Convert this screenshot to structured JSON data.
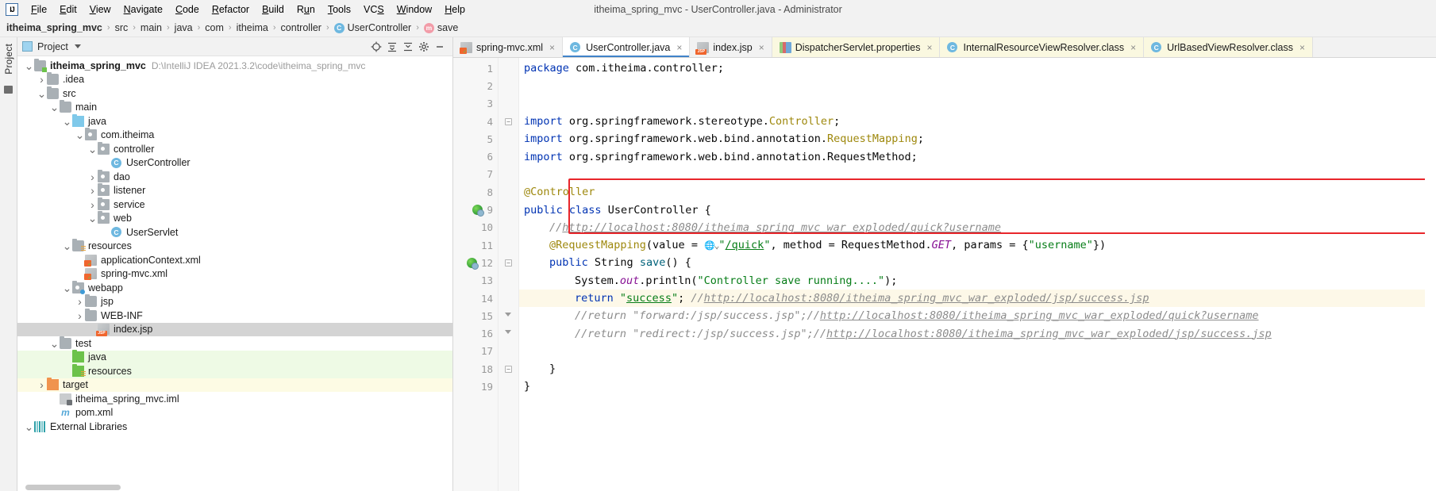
{
  "window": {
    "title": "itheima_spring_mvc - UserController.java - Administrator",
    "logo": "intellij-idea-logo"
  },
  "menu": {
    "items": [
      {
        "label": "File",
        "mnemonic": "F"
      },
      {
        "label": "Edit",
        "mnemonic": "E"
      },
      {
        "label": "View",
        "mnemonic": "V"
      },
      {
        "label": "Navigate",
        "mnemonic": "N"
      },
      {
        "label": "Code",
        "mnemonic": "C"
      },
      {
        "label": "Refactor",
        "mnemonic": "R"
      },
      {
        "label": "Build",
        "mnemonic": "B"
      },
      {
        "label": "Run",
        "mnemonic": "u"
      },
      {
        "label": "Tools",
        "mnemonic": "T"
      },
      {
        "label": "VCS",
        "mnemonic": "S"
      },
      {
        "label": "Window",
        "mnemonic": "W"
      },
      {
        "label": "Help",
        "mnemonic": "H"
      }
    ]
  },
  "breadcrumb": {
    "items": [
      {
        "label": "itheima_spring_mvc",
        "bold": true,
        "icon": ""
      },
      {
        "label": "src",
        "bold": false,
        "icon": ""
      },
      {
        "label": "main",
        "bold": false,
        "icon": ""
      },
      {
        "label": "java",
        "bold": false,
        "icon": ""
      },
      {
        "label": "com",
        "bold": false,
        "icon": ""
      },
      {
        "label": "itheima",
        "bold": false,
        "icon": ""
      },
      {
        "label": "controller",
        "bold": false,
        "icon": ""
      },
      {
        "label": "UserController",
        "bold": false,
        "icon": "class-icon",
        "badge": "C"
      },
      {
        "label": "save",
        "bold": false,
        "icon": "method-icon",
        "badge": "m"
      }
    ],
    "separator": "›"
  },
  "tool_window_strip": {
    "label": "Project"
  },
  "project_panel": {
    "header": {
      "title": "Project",
      "dropdown": "chevron-down-icon",
      "buttons": [
        "locate-icon",
        "collapse-all-icon",
        "hide-icon",
        "settings-icon",
        "minimize-icon"
      ]
    },
    "tree": [
      {
        "label": "itheima_spring_mvc",
        "path": "D:\\IntelliJ IDEA 2021.3.2\\code\\itheima_spring_mvc",
        "indent": 0,
        "arrow": "v",
        "icon": "module-folder",
        "bold": true,
        "bg": ""
      },
      {
        "label": ".idea",
        "path": "",
        "indent": 1,
        "arrow": ">",
        "icon": "folder",
        "bold": false,
        "bg": ""
      },
      {
        "label": "src",
        "path": "",
        "indent": 1,
        "arrow": "v",
        "icon": "folder",
        "bold": false,
        "bg": ""
      },
      {
        "label": "main",
        "path": "",
        "indent": 2,
        "arrow": "v",
        "icon": "folder",
        "bold": false,
        "bg": ""
      },
      {
        "label": "java",
        "path": "",
        "indent": 3,
        "arrow": "v",
        "icon": "source-folder",
        "bold": false,
        "bg": ""
      },
      {
        "label": "com.itheima",
        "path": "",
        "indent": 4,
        "arrow": "v",
        "icon": "package",
        "bold": false,
        "bg": ""
      },
      {
        "label": "controller",
        "path": "",
        "indent": 5,
        "arrow": "v",
        "icon": "package",
        "bold": false,
        "bg": ""
      },
      {
        "label": "UserController",
        "path": "",
        "indent": 6,
        "arrow": "",
        "icon": "java-class",
        "bold": false,
        "bg": ""
      },
      {
        "label": "dao",
        "path": "",
        "indent": 5,
        "arrow": ">",
        "icon": "package",
        "bold": false,
        "bg": ""
      },
      {
        "label": "listener",
        "path": "",
        "indent": 5,
        "arrow": ">",
        "icon": "package",
        "bold": false,
        "bg": ""
      },
      {
        "label": "service",
        "path": "",
        "indent": 5,
        "arrow": ">",
        "icon": "package",
        "bold": false,
        "bg": ""
      },
      {
        "label": "web",
        "path": "",
        "indent": 5,
        "arrow": "v",
        "icon": "package",
        "bold": false,
        "bg": ""
      },
      {
        "label": "UserServlet",
        "path": "",
        "indent": 6,
        "arrow": "",
        "icon": "java-class",
        "bold": false,
        "bg": ""
      },
      {
        "label": "resources",
        "path": "",
        "indent": 3,
        "arrow": "v",
        "icon": "resources-folder",
        "bold": false,
        "bg": ""
      },
      {
        "label": "applicationContext.xml",
        "path": "",
        "indent": 4,
        "arrow": "",
        "icon": "spring-xml",
        "bold": false,
        "bg": ""
      },
      {
        "label": "spring-mvc.xml",
        "path": "",
        "indent": 4,
        "arrow": "",
        "icon": "spring-xml",
        "bold": false,
        "bg": ""
      },
      {
        "label": "webapp",
        "path": "",
        "indent": 3,
        "arrow": "v",
        "icon": "webapp-folder",
        "bold": false,
        "bg": ""
      },
      {
        "label": "jsp",
        "path": "",
        "indent": 4,
        "arrow": ">",
        "icon": "folder",
        "bold": false,
        "bg": ""
      },
      {
        "label": "WEB-INF",
        "path": "",
        "indent": 4,
        "arrow": ">",
        "icon": "folder",
        "bold": false,
        "bg": ""
      },
      {
        "label": "index.jsp",
        "path": "",
        "indent": 5,
        "arrow": "",
        "icon": "jsp-file",
        "bold": false,
        "bg": "selected"
      },
      {
        "label": "test",
        "path": "",
        "indent": 2,
        "arrow": "v",
        "icon": "folder",
        "bold": false,
        "bg": ""
      },
      {
        "label": "java",
        "path": "",
        "indent": 3,
        "arrow": "",
        "icon": "test-source-folder",
        "bold": false,
        "bg": "green"
      },
      {
        "label": "resources",
        "path": "",
        "indent": 3,
        "arrow": "",
        "icon": "test-resources-folder",
        "bold": false,
        "bg": "green"
      },
      {
        "label": "target",
        "path": "",
        "indent": 1,
        "arrow": ">",
        "icon": "excluded-folder",
        "bold": false,
        "bg": "yellow"
      },
      {
        "label": "itheima_spring_mvc.iml",
        "path": "",
        "indent": 2,
        "arrow": "",
        "icon": "iml-file",
        "bold": false,
        "bg": ""
      },
      {
        "label": "pom.xml",
        "path": "",
        "indent": 2,
        "arrow": "",
        "icon": "maven-file",
        "bold": false,
        "bg": ""
      },
      {
        "label": "External Libraries",
        "path": "",
        "indent": 0,
        "arrow": "v",
        "icon": "libraries",
        "bold": false,
        "bg": ""
      }
    ]
  },
  "editor_tabs": [
    {
      "label": "spring-mvc.xml",
      "icon": "spring-xml",
      "active": false,
      "readonly": false,
      "close": "×"
    },
    {
      "label": "UserController.java",
      "icon": "java-class",
      "active": true,
      "readonly": false,
      "close": "×"
    },
    {
      "label": "index.jsp",
      "icon": "jsp-file",
      "active": false,
      "readonly": false,
      "close": "×"
    },
    {
      "label": "DispatcherServlet.properties",
      "icon": "properties-file",
      "active": false,
      "readonly": true,
      "close": "×"
    },
    {
      "label": "InternalResourceViewResolver.class",
      "icon": "java-class-decompiled",
      "active": false,
      "readonly": true,
      "close": "×"
    },
    {
      "label": "UrlBasedViewResolver.class",
      "icon": "java-class-decompiled",
      "active": false,
      "readonly": true,
      "close": "×"
    }
  ],
  "editor": {
    "file": "UserController.java",
    "highlight_box_color": "#e8262b",
    "current_line_color": "#fdf8e8",
    "lines": [
      {
        "n": "1",
        "gutter": "",
        "fold": "",
        "hl": false
      },
      {
        "n": "2",
        "gutter": "",
        "fold": "",
        "hl": false
      },
      {
        "n": "3",
        "gutter": "",
        "fold": "",
        "hl": false
      },
      {
        "n": "4",
        "gutter": "",
        "fold": "minus",
        "hl": false
      },
      {
        "n": "5",
        "gutter": "",
        "fold": "",
        "hl": false
      },
      {
        "n": "6",
        "gutter": "",
        "fold": "",
        "hl": false
      },
      {
        "n": "7",
        "gutter": "",
        "fold": "",
        "hl": false
      },
      {
        "n": "8",
        "gutter": "",
        "fold": "",
        "hl": false
      },
      {
        "n": "9",
        "gutter": "run",
        "fold": "",
        "hl": false
      },
      {
        "n": "10",
        "gutter": "",
        "fold": "",
        "hl": false
      },
      {
        "n": "11",
        "gutter": "",
        "fold": "",
        "hl": false
      },
      {
        "n": "12",
        "gutter": "run",
        "fold": "minus",
        "hl": false
      },
      {
        "n": "13",
        "gutter": "",
        "fold": "",
        "hl": false
      },
      {
        "n": "14",
        "gutter": "",
        "fold": "",
        "hl": true
      },
      {
        "n": "15",
        "gutter": "",
        "fold": "tri",
        "hl": false
      },
      {
        "n": "16",
        "gutter": "",
        "fold": "tri",
        "hl": false
      },
      {
        "n": "17",
        "gutter": "",
        "fold": "",
        "hl": false
      },
      {
        "n": "18",
        "gutter": "",
        "fold": "minus",
        "hl": false
      },
      {
        "n": "19",
        "gutter": "",
        "fold": "",
        "hl": false
      }
    ],
    "code_text": {
      "l1_kw": "package",
      "l1_rest": " com.itheima.controller;",
      "l4_kw": "import",
      "l4_pkg": " org.springframework.stereotype.",
      "l4_cls": "Controller",
      "l4_end": ";",
      "l5_kw": "import",
      "l5_pkg": " org.springframework.web.bind.annotation.",
      "l5_cls": "RequestMapping",
      "l5_end": ";",
      "l6_kw": "import",
      "l6_pkg": " org.springframework.web.bind.annotation.RequestMethod;",
      "l8_ann": "@Controller",
      "l9_kw1": "public",
      "l9_kw2": "class",
      "l9_name": " UserController {",
      "l10_cmt": "//",
      "l10_url": "http://localhost:8080/itheima_spring_mvc_war_exploded/quick?username",
      "l11_ann": "@RequestMapping",
      "l11_p1": "(value = ",
      "l11_globe": "ⓢ",
      "l11_q1": "\"",
      "l11_val": "/quick",
      "l11_q2": "\"",
      "l11_p2": ", method = RequestMethod.",
      "l11_stat": "GET",
      "l11_p3": ", params = {",
      "l11_s2": "\"username\"",
      "l11_p4": "})",
      "l12_kw": "public",
      "l12_type": " String ",
      "l12_fn": "save",
      "l12_end": "() {",
      "l13_a": "System.",
      "l13_out": "out",
      "l13_b": ".println(",
      "l13_str": "\"Controller save running....\"",
      "l13_c": ");",
      "l14_kw": "return",
      "l14_str": "success",
      "l14_semi": ";",
      "l14_cmt": "//",
      "l14_url": "http://localhost:8080/itheima_spring_mvc_war_exploded/jsp/success.jsp",
      "l15_cmt": "//return \"forward:/jsp/success.jsp\";//",
      "l15_url": "http://localhost:8080/itheima_spring_mvc_war_exploded/quick?username",
      "l16_cmt": "//return \"redirect:/jsp/success.jsp\";//",
      "l16_url": "http://localhost:8080/itheima_spring_mvc_war_exploded/jsp/success.jsp",
      "l18_brace": "}",
      "l19_brace": "}"
    }
  }
}
